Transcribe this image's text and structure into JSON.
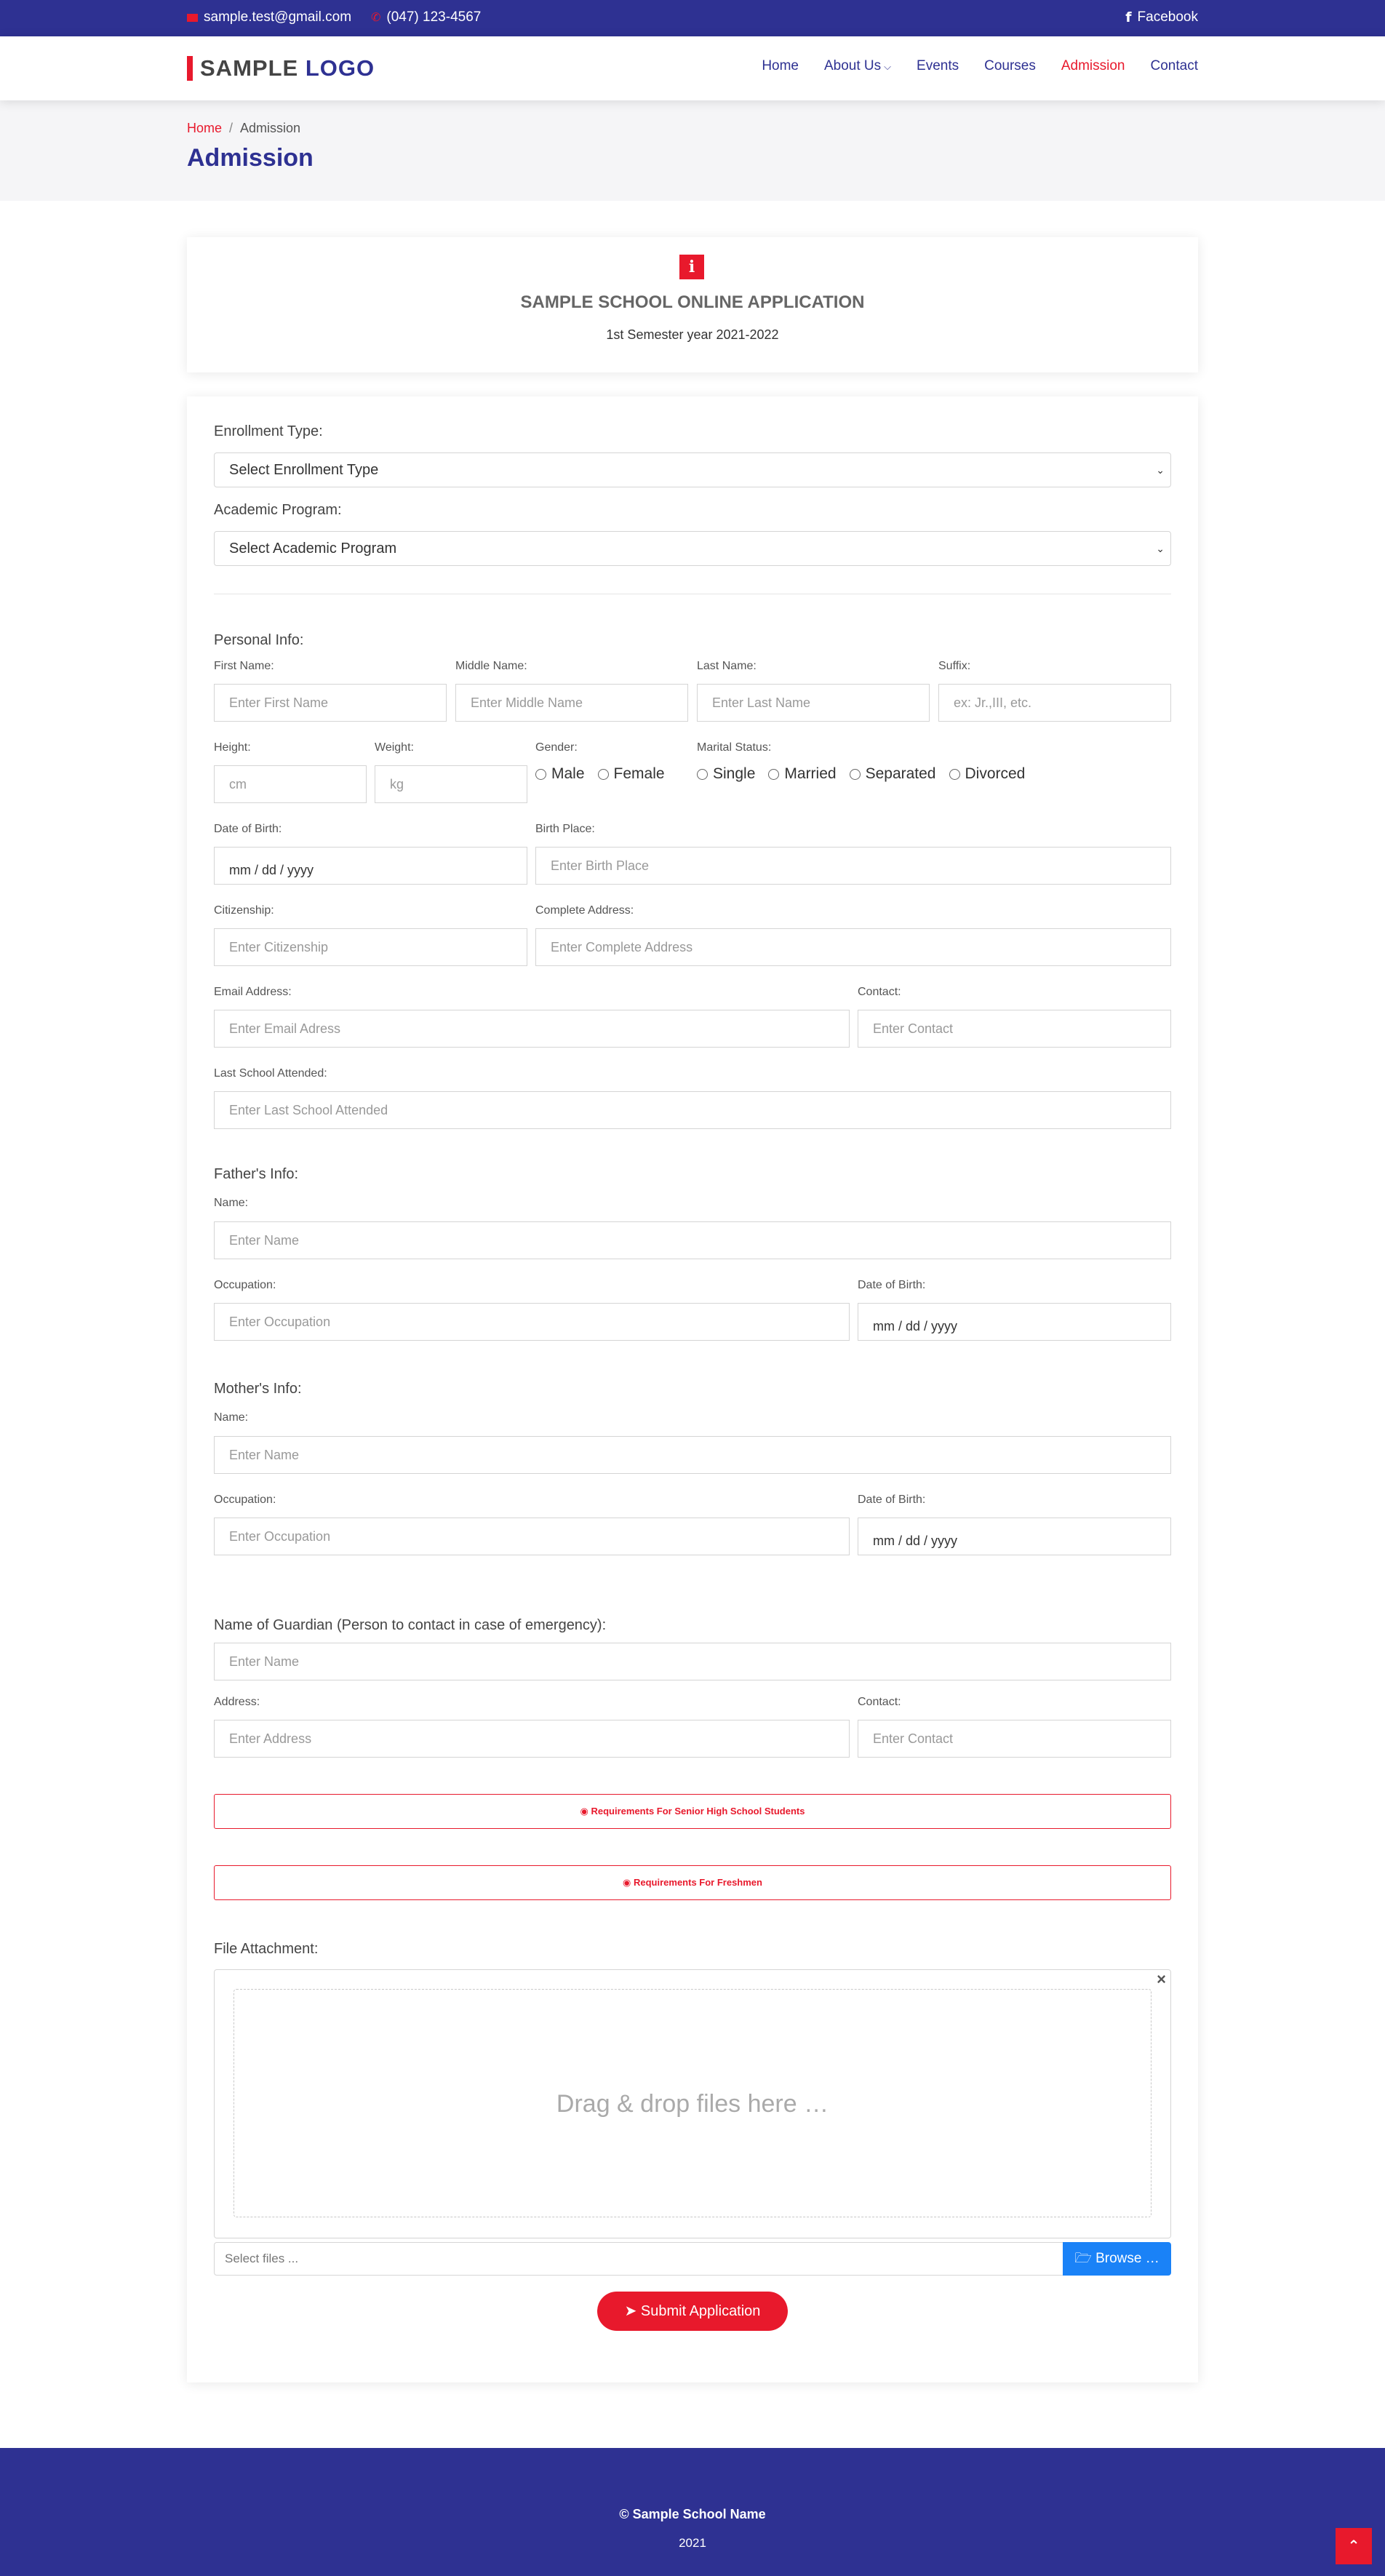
{
  "topbar": {
    "email": "sample.test@gmail.com",
    "phone": "(047) 123-4567",
    "facebook": "Facebook"
  },
  "header": {
    "logo_part1": "SAMPLE",
    "logo_part2": "LOGO",
    "nav": [
      "Home",
      "About Us",
      "Events",
      "Courses",
      "Admission",
      "Contact"
    ],
    "active_nav": "Admission"
  },
  "breadcrumb": {
    "home": "Home",
    "separator": "/",
    "current": "Admission",
    "title": "Admission"
  },
  "intro": {
    "icon": "i",
    "title": "SAMPLE SCHOOL ONLINE APPLICATION",
    "subtitle": "1st Semester year 2021-2022"
  },
  "form": {
    "enrollment_label": "Enrollment Type:",
    "enrollment_value": "Select Enrollment Type",
    "program_label": "Academic Program:",
    "program_value": "Select Academic Program",
    "personal_title": "Personal Info:",
    "first_name_label": "First Name:",
    "first_name_ph": "Enter First Name",
    "middle_name_label": "Middle Name:",
    "middle_name_ph": "Enter Middle Name",
    "last_name_label": "Last Name:",
    "last_name_ph": "Enter Last Name",
    "suffix_label": "Suffix:",
    "suffix_ph": "ex: Jr.,III, etc.",
    "height_label": "Height:",
    "height_ph": "cm",
    "weight_label": "Weight:",
    "weight_ph": "kg",
    "gender_label": "Gender:",
    "gender_options": [
      "Male",
      "Female"
    ],
    "marital_label": "Marital Status:",
    "marital_options": [
      "Single",
      "Married",
      "Separated",
      "Divorced"
    ],
    "dob_label": "Date of Birth:",
    "date_ph": "mm / dd / yyyy",
    "birthplace_label": "Birth Place:",
    "birthplace_ph": "Enter Birth Place",
    "citizenship_label": "Citizenship:",
    "citizenship_ph": "Enter Citizenship",
    "address_label": "Complete Address:",
    "address_ph": "Enter Complete Address",
    "email_label": "Email Address:",
    "email_ph": "Enter Email Adress",
    "contact_label": "Contact:",
    "contact_ph": "Enter Contact",
    "last_school_label": "Last School Attended:",
    "last_school_ph": "Enter Last School Attended",
    "father_title": "Father's Info:",
    "mother_title": "Mother's Info:",
    "name_label": "Name:",
    "name_ph": "Enter Name",
    "occupation_label": "Occupation:",
    "occupation_ph": "Enter Occupation",
    "guardian_title": "Name of Guardian (Person to contact in case of emergency):",
    "address_short_label": "Address:",
    "address_short_ph": "Enter Address",
    "req_senior": "Requirements For Senior High School Students",
    "req_freshmen": "Requirements For Freshmen",
    "file_title": "File Attachment:",
    "drop_text": "Drag & drop files here …",
    "close_glyph": "×",
    "file_ph": "Select files ...",
    "browse": "Browse …",
    "submit": "Submit Application"
  },
  "footer": {
    "name": "© Sample School Name",
    "year": "2021"
  }
}
